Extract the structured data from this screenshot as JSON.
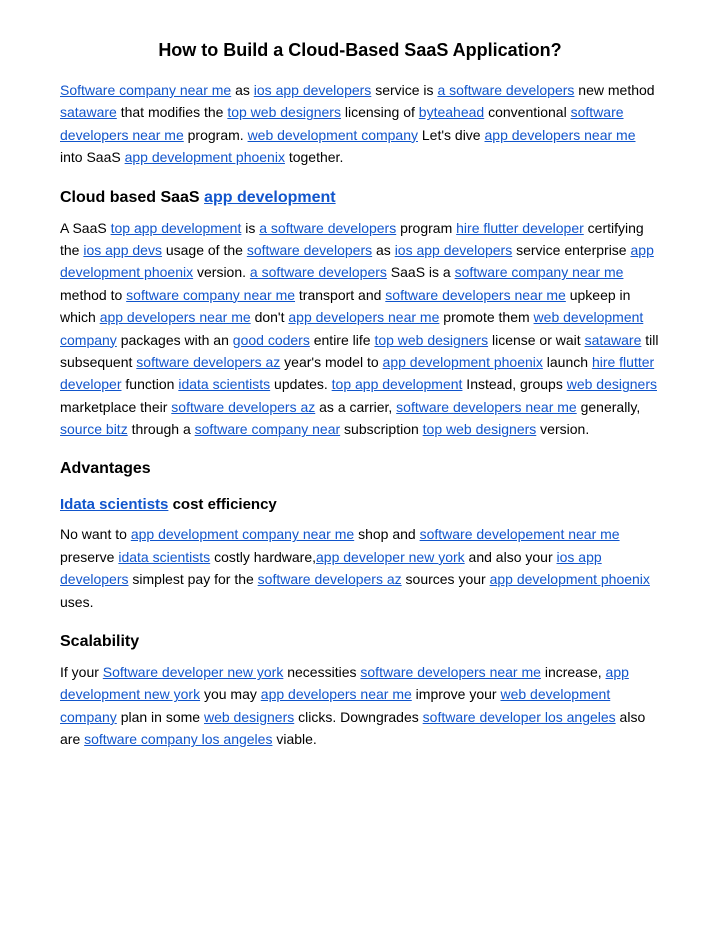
{
  "page": {
    "title": "How to Build a Cloud-Based SaaS Application?",
    "intro": {
      "text_parts": [
        {
          "type": "link",
          "text": "Software company near me",
          "href": "#"
        },
        {
          "type": "text",
          "text": " as "
        },
        {
          "type": "link",
          "text": "ios app developers",
          "href": "#"
        },
        {
          "type": "text",
          "text": " service is "
        },
        {
          "type": "link",
          "text": "a software developers",
          "href": "#"
        },
        {
          "type": "text",
          "text": " new method "
        },
        {
          "type": "link",
          "text": "sataware",
          "href": "#"
        },
        {
          "type": "text",
          "text": " that modifies the "
        },
        {
          "type": "link",
          "text": "top web designers",
          "href": "#"
        },
        {
          "type": "text",
          "text": " licensing of "
        },
        {
          "type": "link",
          "text": "byteahead",
          "href": "#"
        },
        {
          "type": "text",
          "text": " conventional "
        },
        {
          "type": "link",
          "text": "software developers near me",
          "href": "#"
        },
        {
          "type": "text",
          "text": " program. "
        },
        {
          "type": "link",
          "text": "web development company",
          "href": "#"
        },
        {
          "type": "text",
          "text": " Let's dive "
        },
        {
          "type": "link",
          "text": "app developers near me",
          "href": "#"
        },
        {
          "type": "text",
          "text": " into SaaS "
        },
        {
          "type": "link",
          "text": "app development phoenix",
          "href": "#"
        },
        {
          "type": "text",
          "text": " together."
        }
      ]
    },
    "cloud_section": {
      "heading_text": "Cloud based SaaS ",
      "heading_link": "app development",
      "body": [
        {
          "type": "text",
          "text": "A SaaS "
        },
        {
          "type": "link",
          "text": "top app development",
          "href": "#"
        },
        {
          "type": "text",
          "text": " is "
        },
        {
          "type": "link",
          "text": "a software developers",
          "href": "#"
        },
        {
          "type": "text",
          "text": " program "
        },
        {
          "type": "link",
          "text": "hire flutter developer",
          "href": "#"
        },
        {
          "type": "text",
          "text": " certifying the "
        },
        {
          "type": "link",
          "text": "ios app devs",
          "href": "#"
        },
        {
          "type": "text",
          "text": " usage of the "
        },
        {
          "type": "link",
          "text": "software developers",
          "href": "#"
        },
        {
          "type": "text",
          "text": " as "
        },
        {
          "type": "link",
          "text": "ios app developers",
          "href": "#"
        },
        {
          "type": "text",
          "text": " service enterprise "
        },
        {
          "type": "link",
          "text": "app development phoenix",
          "href": "#"
        },
        {
          "type": "text",
          "text": " version. "
        },
        {
          "type": "link",
          "text": "a software developers",
          "href": "#"
        },
        {
          "type": "text",
          "text": " SaaS is a "
        },
        {
          "type": "link",
          "text": "software company near me",
          "href": "#"
        },
        {
          "type": "text",
          "text": " method to "
        },
        {
          "type": "link",
          "text": "software company near me",
          "href": "#"
        },
        {
          "type": "text",
          "text": " transport and "
        },
        {
          "type": "link",
          "text": "software developers near me",
          "href": "#"
        },
        {
          "type": "text",
          "text": " upkeep in which "
        },
        {
          "type": "link",
          "text": "app developers near me",
          "href": "#"
        },
        {
          "type": "text",
          "text": " don't "
        },
        {
          "type": "link",
          "text": "app developers near me",
          "href": "#"
        },
        {
          "type": "text",
          "text": " promote them "
        },
        {
          "type": "link",
          "text": "web development company",
          "href": "#"
        },
        {
          "type": "text",
          "text": " packages with an "
        },
        {
          "type": "link",
          "text": "good coders",
          "href": "#"
        },
        {
          "type": "text",
          "text": " entire life "
        },
        {
          "type": "link",
          "text": "top web designers",
          "href": "#"
        },
        {
          "type": "text",
          "text": " license or wait "
        },
        {
          "type": "link",
          "text": "sataware",
          "href": "#"
        },
        {
          "type": "text",
          "text": " till subsequent "
        },
        {
          "type": "link",
          "text": "software developers az",
          "href": "#"
        },
        {
          "type": "text",
          "text": " year's model to "
        },
        {
          "type": "link",
          "text": "app development phoenix",
          "href": "#"
        },
        {
          "type": "text",
          "text": " launch "
        },
        {
          "type": "link",
          "text": "hire flutter developer",
          "href": "#"
        },
        {
          "type": "text",
          "text": " function "
        },
        {
          "type": "link",
          "text": "idata scientists",
          "href": "#"
        },
        {
          "type": "text",
          "text": " updates. "
        },
        {
          "type": "link",
          "text": "top app development",
          "href": "#"
        },
        {
          "type": "text",
          "text": " Instead, groups "
        },
        {
          "type": "link",
          "text": "web designers",
          "href": "#"
        },
        {
          "type": "text",
          "text": " marketplace their "
        },
        {
          "type": "link",
          "text": "software developers az",
          "href": "#"
        },
        {
          "type": "text",
          "text": " as a carrier, "
        },
        {
          "type": "link",
          "text": "software developers near me",
          "href": "#"
        },
        {
          "type": "text",
          "text": " generally, "
        },
        {
          "type": "link",
          "text": "source bitz",
          "href": "#"
        },
        {
          "type": "text",
          "text": " through a "
        },
        {
          "type": "link",
          "text": "software company near",
          "href": "#"
        },
        {
          "type": "text",
          "text": " subscription "
        },
        {
          "type": "link",
          "text": "top web designers",
          "href": "#"
        },
        {
          "type": "text",
          "text": " version."
        }
      ]
    },
    "advantages_section": {
      "heading": "Advantages",
      "sub_heading_link": "Idata scientists",
      "sub_heading_text": " cost efficiency",
      "body": [
        {
          "type": "text",
          "text": "No want to "
        },
        {
          "type": "link",
          "text": "app development company near me",
          "href": "#"
        },
        {
          "type": "text",
          "text": " shop and "
        },
        {
          "type": "link",
          "text": "software developement near me",
          "href": "#"
        },
        {
          "type": "text",
          "text": " preserve "
        },
        {
          "type": "link",
          "text": "idata scientists",
          "href": "#"
        },
        {
          "type": "text",
          "text": " costly hardware,"
        },
        {
          "type": "link",
          "text": "app developer new york",
          "href": "#"
        },
        {
          "type": "text",
          "text": " and also your "
        },
        {
          "type": "link",
          "text": "ios app developers",
          "href": "#"
        },
        {
          "type": "text",
          "text": " simplest pay for the "
        },
        {
          "type": "link",
          "text": "software developers az",
          "href": "#"
        },
        {
          "type": "text",
          "text": " sources your "
        },
        {
          "type": "link",
          "text": "app development phoenix",
          "href": "#"
        },
        {
          "type": "text",
          "text": " uses."
        }
      ]
    },
    "scalability_section": {
      "heading": "Scalability",
      "body": [
        {
          "type": "text",
          "text": "If your "
        },
        {
          "type": "link",
          "text": "Software developer new york",
          "href": "#"
        },
        {
          "type": "text",
          "text": " necessities "
        },
        {
          "type": "link",
          "text": "software developers near me",
          "href": "#"
        },
        {
          "type": "text",
          "text": " increase, "
        },
        {
          "type": "link",
          "text": "app development new york",
          "href": "#"
        },
        {
          "type": "text",
          "text": " you may "
        },
        {
          "type": "link",
          "text": "app developers near me",
          "href": "#"
        },
        {
          "type": "text",
          "text": " improve your "
        },
        {
          "type": "link",
          "text": "web development company",
          "href": "#"
        },
        {
          "type": "text",
          "text": " plan in some "
        },
        {
          "type": "link",
          "text": "web designers",
          "href": "#"
        },
        {
          "type": "text",
          "text": " clicks. Downgrades "
        },
        {
          "type": "link",
          "text": "software developer los angeles",
          "href": "#"
        },
        {
          "type": "text",
          "text": " also are "
        },
        {
          "type": "link",
          "text": "software company los angeles",
          "href": "#"
        },
        {
          "type": "text",
          "text": " viable."
        }
      ]
    }
  }
}
